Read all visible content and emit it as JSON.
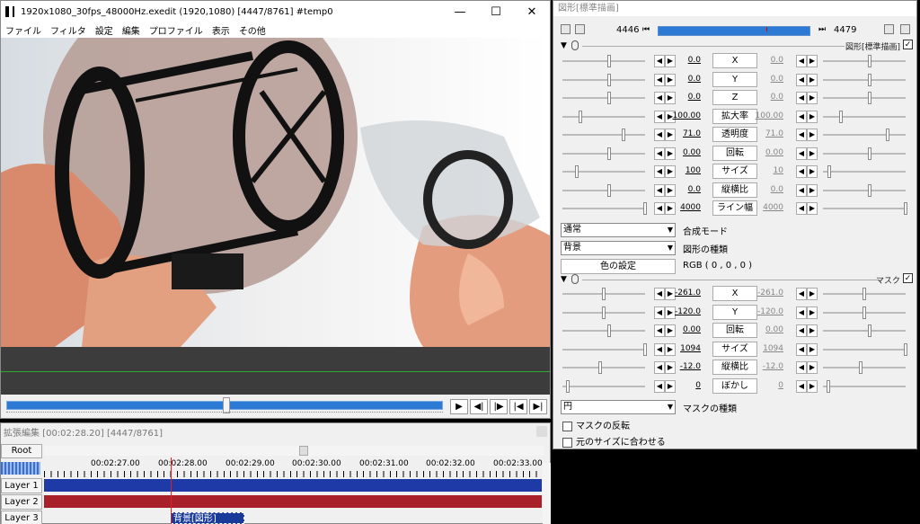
{
  "main_window": {
    "title": "1920x1080_30fps_48000Hz.exedit (1920,1080)  [4447/8761]  #temp0",
    "buttons": {
      "minimize": "—",
      "maximize": "☐",
      "close": "✕"
    },
    "menu": [
      "ファイル",
      "フィルタ",
      "設定",
      "編集",
      "プロファイル",
      "表示",
      "その他"
    ],
    "playback": {
      "play": "▶",
      "prev_frame": "◀|",
      "next_frame": "|▶",
      "to_start": "|◀",
      "to_end": "▶|"
    },
    "seek_position": 0.51
  },
  "timeline": {
    "title": "拡張編集 [00:02:28.20] [4447/8761]",
    "root_label": "Root",
    "ticks": [
      "00:02:27.00",
      "00:02:28.00",
      "00:02:29.00",
      "00:02:30.00",
      "00:02:31.00",
      "00:02:32.00",
      "00:02:33.00"
    ],
    "layers": [
      "Layer 1",
      "Layer 2",
      "Layer 3"
    ],
    "clip3_label": "背景[図形]",
    "colors": {
      "layer1": "#1d3aa6",
      "layer2": "#a8202a",
      "cursor": "#d22222"
    }
  },
  "panel": {
    "title": "図形[標準描画]",
    "frame_start": "4446",
    "frame_end": "4479",
    "nav_prev": "⏮",
    "nav_next": "⏭",
    "section1": {
      "label": "図形[標準描画]",
      "checked": "✓"
    },
    "params1": [
      {
        "value": "0.0",
        "name": "X",
        "end": "0.0"
      },
      {
        "value": "0.0",
        "name": "Y",
        "end": "0.0"
      },
      {
        "value": "0.0",
        "name": "Z",
        "end": "0.0"
      },
      {
        "value": "100.00",
        "name": "拡大率",
        "end": "100.00"
      },
      {
        "value": "71.0",
        "name": "透明度",
        "end": "71.0"
      },
      {
        "value": "0.00",
        "name": "回転",
        "end": "0.00"
      },
      {
        "value": "100",
        "name": "サイズ",
        "end": "10"
      },
      {
        "value": "0.0",
        "name": "縦横比",
        "end": "0.0"
      },
      {
        "value": "4000",
        "name": "ライン幅",
        "end": "4000"
      }
    ],
    "blend_mode": {
      "value": "通常",
      "label": "合成モード"
    },
    "shape_type": {
      "value": "背景",
      "label": "図形の種類"
    },
    "color_button": "色の設定",
    "color_value": "RGB ( 0 , 0 , 0 )",
    "section2": {
      "label": "マスク",
      "checked": "✓"
    },
    "params2": [
      {
        "value": "-261.0",
        "name": "X",
        "end": "-261.0"
      },
      {
        "value": "-120.0",
        "name": "Y",
        "end": "-120.0"
      },
      {
        "value": "0.00",
        "name": "回転",
        "end": "0.00"
      },
      {
        "value": "1094",
        "name": "サイズ",
        "end": "1094"
      },
      {
        "value": "-12.0",
        "name": "縦横比",
        "end": "-12.0"
      },
      {
        "value": "0",
        "name": "ぼかし",
        "end": "0"
      }
    ],
    "mask_type": {
      "value": "円",
      "label": "マスクの種類"
    },
    "mask_invert": "マスクの反転",
    "fit_original": "元のサイズに合わせる"
  }
}
